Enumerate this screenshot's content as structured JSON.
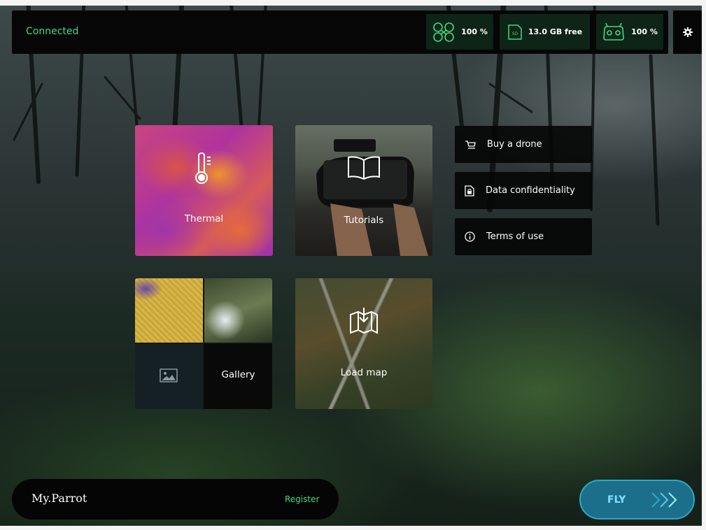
{
  "status": {
    "connection": "Connected"
  },
  "indicators": {
    "drone_battery": "100 %",
    "sd_storage": "13.0 GB free",
    "controller_battery": "100 %",
    "sd_icon_text": "SD"
  },
  "tiles": {
    "thermal": "Thermal",
    "tutorials": "Tutorials",
    "gallery": "Gallery",
    "load_map": "Load map"
  },
  "menu": {
    "buy": "Buy a drone",
    "confidentiality": "Data confidentiality",
    "terms": "Terms of use"
  },
  "account": {
    "brand": "My.Parrot",
    "register": "Register"
  },
  "fly": {
    "label": "FLY"
  },
  "icons": {
    "drone": "drone-icon",
    "sd": "sd-card-icon",
    "controller": "controller-icon",
    "settings": "gear-icon",
    "thermal": "thermometer-icon",
    "tutorials": "book-icon",
    "gallery": "image-icon",
    "map": "map-download-icon",
    "buy": "cart-icon",
    "confidentiality": "lock-document-icon",
    "terms": "info-icon"
  },
  "colors": {
    "accent": "#3ddc84",
    "fly": "#1c6f8a",
    "fly_text": "#7fe2ff"
  }
}
